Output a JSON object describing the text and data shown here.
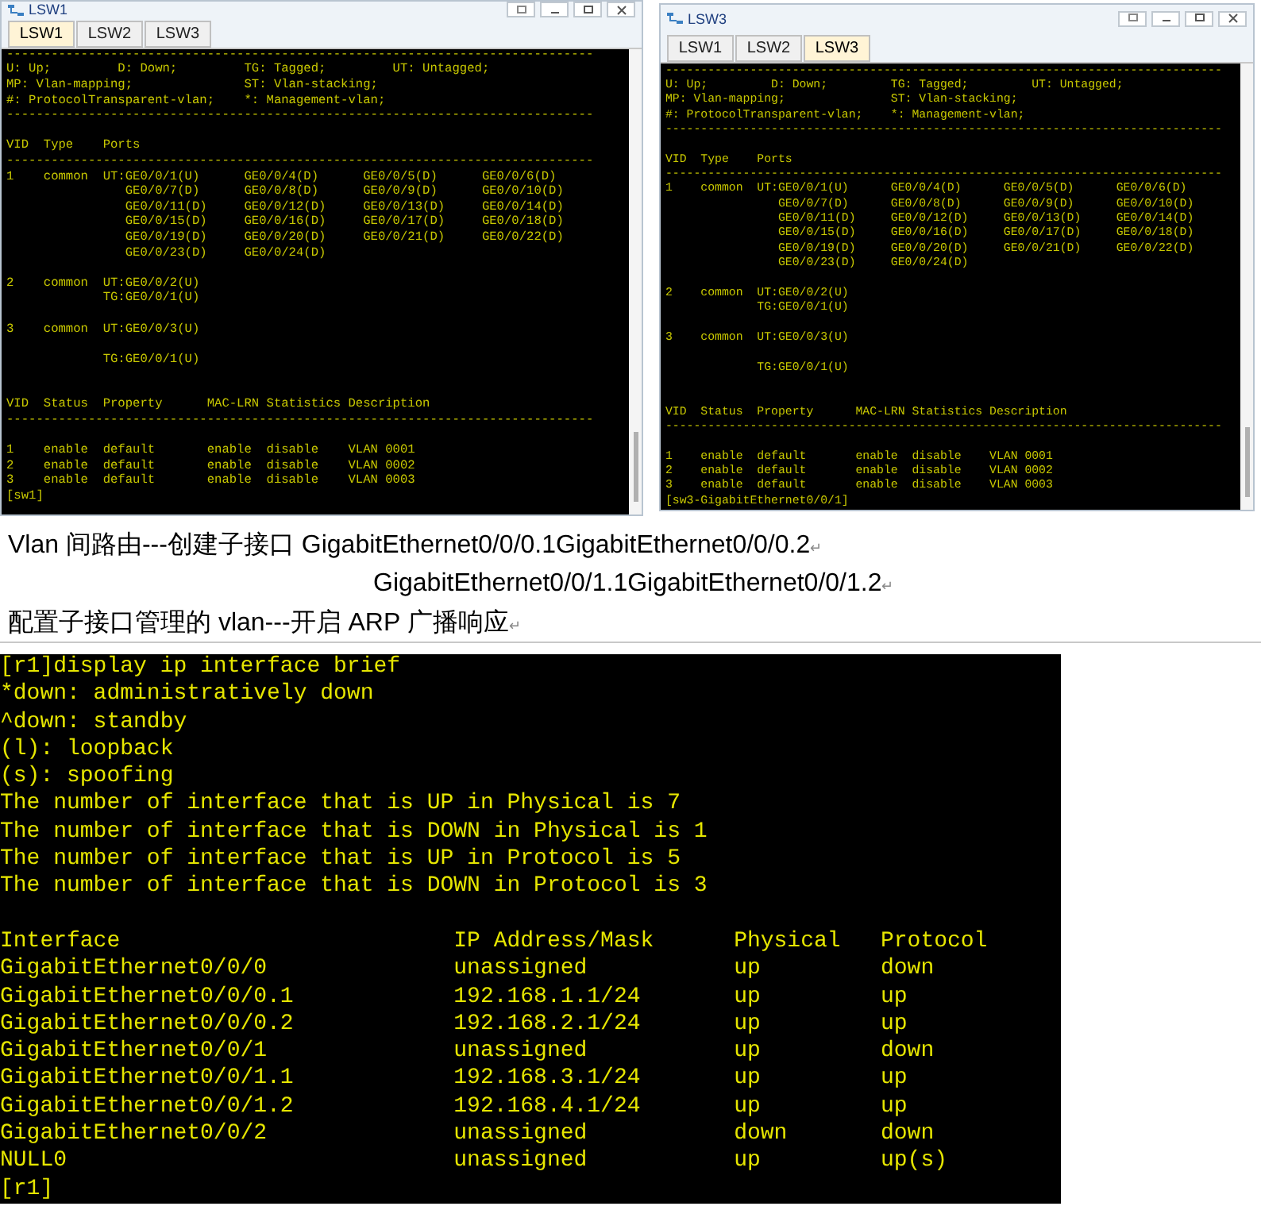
{
  "windows": [
    {
      "title": "LSW1",
      "tabs": [
        {
          "label": "LSW1",
          "selected": true
        },
        {
          "label": "LSW2",
          "selected": false
        },
        {
          "label": "LSW3",
          "selected": false
        }
      ],
      "lines": [
        {
          "kind": "text",
          "text": "-------------------------------------------------------------------------------"
        },
        {
          "kind": "text",
          "text": "U: Up;         D: Down;         TG: Tagged;         UT: Untagged;"
        },
        {
          "kind": "text",
          "text": "MP: Vlan-mapping;               ST: Vlan-stacking;"
        },
        {
          "kind": "text",
          "text": "#: ProtocolTransparent-vlan;    *: Management-vlan;"
        },
        {
          "kind": "text",
          "text": "-------------------------------------------------------------------------------"
        },
        {
          "kind": "blank"
        },
        {
          "kind": "text",
          "text": "VID  Type    Ports"
        },
        {
          "kind": "text",
          "text": "-------------------------------------------------------------------------------"
        },
        {
          "kind": "text",
          "text": "1    common  UT:GE0/0/1(U)      GE0/0/4(D)      GE0/0/5(D)      GE0/0/6(D)"
        },
        {
          "kind": "text",
          "text": "                GE0/0/7(D)      GE0/0/8(D)      GE0/0/9(D)      GE0/0/10(D)"
        },
        {
          "kind": "text",
          "text": "                GE0/0/11(D)     GE0/0/12(D)     GE0/0/13(D)     GE0/0/14(D)"
        },
        {
          "kind": "text",
          "text": "                GE0/0/15(D)     GE0/0/16(D)     GE0/0/17(D)     GE0/0/18(D)"
        },
        {
          "kind": "text",
          "text": "                GE0/0/19(D)     GE0/0/20(D)     GE0/0/21(D)     GE0/0/22(D)"
        },
        {
          "kind": "text",
          "text": "                GE0/0/23(D)     GE0/0/24(D)"
        },
        {
          "kind": "blank"
        },
        {
          "kind": "text",
          "text": "2    common  UT:GE0/0/2(U)"
        },
        {
          "kind": "text",
          "text": "             TG:GE0/0/1(U)"
        },
        {
          "kind": "blank"
        },
        {
          "kind": "text",
          "text": "3    common  UT:GE0/0/3(U)"
        },
        {
          "kind": "blank"
        },
        {
          "kind": "text",
          "text": "             TG:GE0/0/1(U)"
        },
        {
          "kind": "blank"
        },
        {
          "kind": "blank"
        },
        {
          "kind": "text",
          "text": "VID  Status  Property      MAC-LRN Statistics Description"
        },
        {
          "kind": "text",
          "text": "-------------------------------------------------------------------------------"
        },
        {
          "kind": "blank"
        },
        {
          "kind": "text",
          "text": "1    enable  default       enable  disable    VLAN 0001"
        },
        {
          "kind": "text",
          "text": "2    enable  default       enable  disable    VLAN 0002"
        },
        {
          "kind": "text",
          "text": "3    enable  default       enable  disable    VLAN 0003"
        },
        {
          "kind": "text",
          "text": "[sw1]"
        }
      ]
    },
    {
      "title": "LSW3",
      "tabs": [
        {
          "label": "LSW1",
          "selected": false
        },
        {
          "label": "LSW2",
          "selected": false
        },
        {
          "label": "LSW3",
          "selected": true
        }
      ],
      "lines": [
        {
          "kind": "text",
          "text": "-------------------------------------------------------------------------------"
        },
        {
          "kind": "text",
          "text": "U: Up;         D: Down;         TG: Tagged;         UT: Untagged;"
        },
        {
          "kind": "text",
          "text": "MP: Vlan-mapping;               ST: Vlan-stacking;"
        },
        {
          "kind": "text",
          "text": "#: ProtocolTransparent-vlan;    *: Management-vlan;"
        },
        {
          "kind": "text",
          "text": "-------------------------------------------------------------------------------"
        },
        {
          "kind": "blank"
        },
        {
          "kind": "text",
          "text": "VID  Type    Ports"
        },
        {
          "kind": "text",
          "text": "-------------------------------------------------------------------------------"
        },
        {
          "kind": "text",
          "text": "1    common  UT:GE0/0/1(U)      GE0/0/4(D)      GE0/0/5(D)      GE0/0/6(D)"
        },
        {
          "kind": "text",
          "text": "                GE0/0/7(D)      GE0/0/8(D)      GE0/0/9(D)      GE0/0/10(D)"
        },
        {
          "kind": "text",
          "text": "                GE0/0/11(D)     GE0/0/12(D)     GE0/0/13(D)     GE0/0/14(D)"
        },
        {
          "kind": "text",
          "text": "                GE0/0/15(D)     GE0/0/16(D)     GE0/0/17(D)     GE0/0/18(D)"
        },
        {
          "kind": "text",
          "text": "                GE0/0/19(D)     GE0/0/20(D)     GE0/0/21(D)     GE0/0/22(D)"
        },
        {
          "kind": "text",
          "text": "                GE0/0/23(D)     GE0/0/24(D)"
        },
        {
          "kind": "blank"
        },
        {
          "kind": "text",
          "text": "2    common  UT:GE0/0/2(U)"
        },
        {
          "kind": "text",
          "text": "             TG:GE0/0/1(U)"
        },
        {
          "kind": "blank"
        },
        {
          "kind": "text",
          "text": "3    common  UT:GE0/0/3(U)"
        },
        {
          "kind": "blank"
        },
        {
          "kind": "text",
          "text": "             TG:GE0/0/1(U)"
        },
        {
          "kind": "blank"
        },
        {
          "kind": "blank"
        },
        {
          "kind": "text",
          "text": "VID  Status  Property      MAC-LRN Statistics Description"
        },
        {
          "kind": "text",
          "text": "-------------------------------------------------------------------------------"
        },
        {
          "kind": "blank"
        },
        {
          "kind": "text",
          "text": "1    enable  default       enable  disable    VLAN 0001"
        },
        {
          "kind": "text",
          "text": "2    enable  default       enable  disable    VLAN 0002"
        },
        {
          "kind": "text",
          "text": "3    enable  default       enable  disable    VLAN 0003"
        },
        {
          "kind": "text",
          "text": "[sw3-GigabitEthernet0/0/1]"
        }
      ]
    }
  ],
  "paragraphs": [
    {
      "text": "Vlan 间路由---创建子接口 GigabitEthernet0/0/0.1GigabitEthernet0/0/0.2",
      "mark": "↵"
    },
    {
      "text": "GigabitEthernet0/0/1.1GigabitEthernet0/0/1.2",
      "mark": "↵"
    },
    {
      "text": "配置子接口管理的 vlan---开启 ARP 广播响应",
      "mark": "↵"
    }
  ],
  "router_terminal": {
    "lines": [
      {
        "kind": "text",
        "text": "[r1]display ip interface brief"
      },
      {
        "kind": "text",
        "text": "*down: administratively down"
      },
      {
        "kind": "text",
        "text": "^down: standby"
      },
      {
        "kind": "text",
        "text": "(l): loopback"
      },
      {
        "kind": "text",
        "text": "(s): spoofing"
      },
      {
        "kind": "text",
        "text": "The number of interface that is UP in Physical is 7"
      },
      {
        "kind": "text",
        "text": "The number of interface that is DOWN in Physical is 1"
      },
      {
        "kind": "text",
        "text": "The number of interface that is UP in Protocol is 5"
      },
      {
        "kind": "text",
        "text": "The number of interface that is DOWN in Protocol is 3"
      },
      {
        "kind": "blank"
      },
      {
        "kind": "text",
        "text": "Interface                         IP Address/Mask      Physical   Protocol"
      },
      {
        "kind": "text",
        "text": "GigabitEthernet0/0/0              unassigned           up         down"
      },
      {
        "kind": "text",
        "text": "GigabitEthernet0/0/0.1            192.168.1.1/24       up         up"
      },
      {
        "kind": "text",
        "text": "GigabitEthernet0/0/0.2            192.168.2.1/24       up         up"
      },
      {
        "kind": "text",
        "text": "GigabitEthernet0/0/1              unassigned           up         down"
      },
      {
        "kind": "text",
        "text": "GigabitEthernet0/0/1.1            192.168.3.1/24       up         up"
      },
      {
        "kind": "text",
        "text": "GigabitEthernet0/0/1.2            192.168.4.1/24       up         up"
      },
      {
        "kind": "text",
        "text": "GigabitEthernet0/0/2              unassigned           down       down"
      },
      {
        "kind": "text",
        "text": "NULL0                             unassigned           up         up(s)"
      },
      {
        "kind": "text",
        "text": "[r1]"
      }
    ]
  }
}
